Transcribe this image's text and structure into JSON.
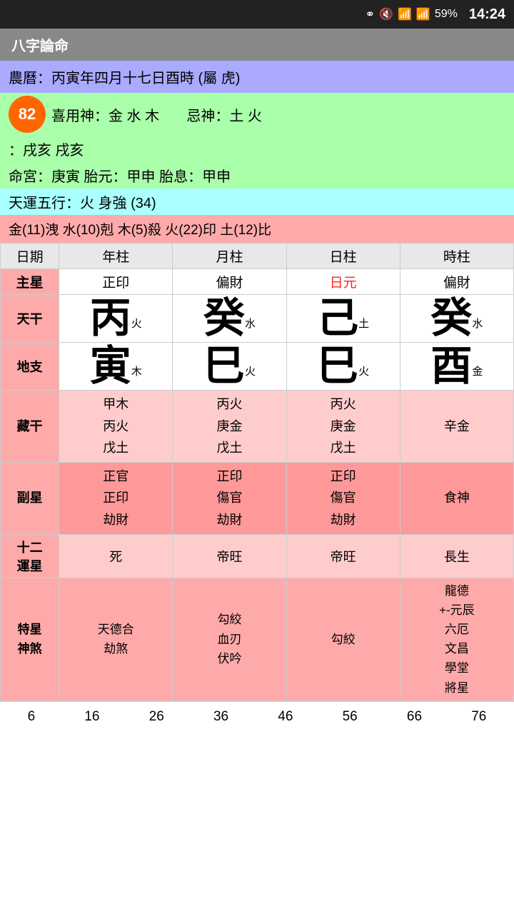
{
  "statusBar": {
    "battery": "59%",
    "time": "14:24"
  },
  "titleBar": {
    "title": "八字論命"
  },
  "lunarRow": {
    "text": "農曆：丙寅年四月十七日酉時 (屬 虎)"
  },
  "xiyongRow": {
    "prefix": "喜用神：金 水 木",
    "suffix": "忌神：土 火",
    "score": "82"
  },
  "chonghexingRow": {
    "text": "：戌亥 戌亥"
  },
  "minggongRow": {
    "text": "命宮：庚寅      胎元：甲申      胎息：甲申"
  },
  "tianyunRow": {
    "text": "天運五行：火                    身強 (34)"
  },
  "wuxingRow": {
    "text": "金(11)洩  水(10)剋  木(5)殺  火(22)印  土(12)比"
  },
  "tableHeaders": [
    "日期",
    "年柱",
    "月柱",
    "日柱",
    "時柱"
  ],
  "zhuxingRow": {
    "label": "主星",
    "nian": "正印",
    "yue": "偏財",
    "ri": "日元",
    "shi": "偏財",
    "riIsRed": true
  },
  "tianganRow": {
    "label": "天干",
    "nian": {
      "char": "丙",
      "sub": "火"
    },
    "yue": {
      "char": "癸",
      "sub": "水"
    },
    "ri": {
      "char": "己",
      "sub": "土"
    },
    "shi": {
      "char": "癸",
      "sub": "水"
    }
  },
  "dizhiRow": {
    "label": "地支",
    "nian": {
      "char": "寅",
      "sub": "木"
    },
    "yue": {
      "char": "巳",
      "sub": "火"
    },
    "ri": {
      "char": "巳",
      "sub": "火"
    },
    "shi": {
      "char": "酉",
      "sub": "金"
    }
  },
  "zangganRow": {
    "label": "藏干",
    "nian": "甲木\n丙火\n戊土",
    "yue": "丙火\n庚金\n戊土",
    "ri": "丙火\n庚金\n戊土",
    "shi": "辛金"
  },
  "fuxingRow": {
    "label": "副星",
    "nian": "正官\n正印\n劫財",
    "yue": "正印\n傷官\n劫財",
    "ri": "正印\n傷官\n劫財",
    "shi": "食神"
  },
  "yunxingRow": {
    "label": "十二\n運星",
    "nian": "死",
    "yue": "帝旺",
    "ri": "帝旺",
    "shi": "長生"
  },
  "texingRow": {
    "label": "特星\n神煞",
    "nian": "天德合\n劫煞",
    "yue": "勾絞\n血刃\n伏吟",
    "ri": "勾絞",
    "shi": "龍德\n+-元辰\n六厄\n文昌\n學堂\n將星"
  },
  "bottomNumbers": [
    "6",
    "16",
    "26",
    "36",
    "46",
    "56",
    "66",
    "76"
  ]
}
